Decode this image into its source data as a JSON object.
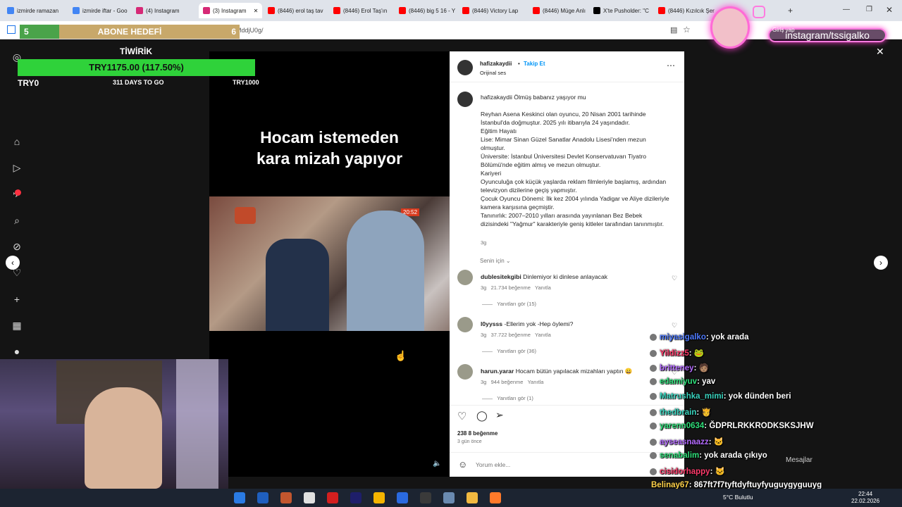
{
  "browser": {
    "tabs": [
      {
        "label": "izmirde ramazan",
        "color": "#4285f4"
      },
      {
        "label": "izmirde iftar - Goo",
        "color": "#4285f4"
      },
      {
        "label": "(4) Instagram",
        "color": "#d62976"
      },
      {
        "label": "(3) Instagram",
        "color": "#d62976",
        "active": true
      },
      {
        "label": "(8446) erol taş tav",
        "color": "#ff0000"
      },
      {
        "label": "(8446) Erol Taş'ın",
        "color": "#ff0000"
      },
      {
        "label": "(8446) big 5 16 - Y",
        "color": "#ff0000"
      },
      {
        "label": "(8446) Victory Lap",
        "color": "#ff0000"
      },
      {
        "label": "(8446) Müge Anlı",
        "color": "#ff0000"
      },
      {
        "label": "X'te Pusholder: \"C",
        "color": "#000000"
      },
      {
        "label": "(8446) Kızılcık Şer",
        "color": "#ff0000"
      }
    ],
    "url": "com/p/DU78MddjU0g/",
    "login_label": "Giriş yap"
  },
  "goal": {
    "head_left": "5",
    "title": "ABONE HEDEFİ",
    "head_right": "6",
    "name": "TİWİRİK",
    "amount": "TRY1175.00 (117.50%)",
    "progress": 1.0,
    "min": "TRY0",
    "days": "311 DAYS TO GO",
    "max": "TRY1000"
  },
  "video": {
    "caption_line1": "Hocam istemeden",
    "caption_line2": "kara mizah yapıyor",
    "clip_timestamp": "20:52"
  },
  "post": {
    "username": "hafizakaydii",
    "follow_label": "Takip Et",
    "audio": "Orijinal ses",
    "caption_user": "hafizakaydii",
    "caption_text": "Ölmüş babanız yaşıyor mu",
    "description": "Reyhan Asena Keskinci olan oyuncu, 20 Nisan 2001 tarihinde İstanbul'da doğmuştur. 2025 yılı itibarıyla 24 yaşındadır.\nEğitim Hayatı\nLise: Mimar Sinan Güzel Sanatlar Anadolu Lisesi'nden mezun olmuştur.\nÜniversite: İstanbul Üniversitesi Devlet Konservatuvarı Tiyatro Bölümü'nde eğitim almış ve mezun olmuştur.\nKariyeri\nOyunculuğa çok küçük yaşlarda reklam filmleriyle başlamış, ardından televizyon dizilerine geçiş yapmıştır.\nÇocuk Oyuncu Dönemi: İlk kez 2004 yılında Yadigar ve Aliye dizileriyle kamera karşısına geçmiştir.\nTanınırlık: 2007–2010 yılları arasında yayınlanan Bez Bebek dizisindeki \"Yağmur\" karakteriyle geniş kitleler tarafından tanınmıştır.",
    "desc_age": "3g",
    "for_you": "Senin için",
    "comments": [
      {
        "user": "dublesitekgibi",
        "text": "Dinlemiyor ki dinlese anlayacak",
        "age": "3g",
        "likes": "21.734 beğenme",
        "reply": "Yanıtla",
        "view_replies": "Yanıtları gör (15)"
      },
      {
        "user": "l0yysss",
        "text": "-Ellerim yok -Hep öylemi?",
        "age": "3g",
        "likes": "37.722 beğenme",
        "reply": "Yanıtla",
        "view_replies": "Yanıtları gör (36)"
      },
      {
        "user": "harun.yarar",
        "text": "Hocam bütün yapılacak mizahları yaptın 😀",
        "age": "3g",
        "likes": "944 beğenme",
        "reply": "Yanıtla",
        "view_replies": "Yanıtları gör (1)"
      }
    ],
    "like_count": "238 8 beğenme",
    "post_age": "3 gün önce",
    "comment_placeholder": "Yorum ekle..."
  },
  "stream": {
    "instagram_handle": "instagram/tssigalko",
    "messages_label": "Mesajlar"
  },
  "chat": [
    {
      "user": "miyasigalko",
      "text": ": yok arada",
      "color": "#4f7bff"
    },
    {
      "user": "Yildizz5",
      "text": ": 🐸",
      "color": "#ff3b6b"
    },
    {
      "user": "britteney",
      "text": ": 🧑🏽",
      "color": "#b46bff"
    },
    {
      "user": "edamiyuv",
      "text": ": yav",
      "color": "#2fe07a"
    },
    {
      "user": "Matrushka_mimi",
      "text": ": yok dünden beri",
      "color": "#3ad6c0"
    },
    {
      "user": "thedbrain",
      "text": ": 🫅",
      "color": "#3ad6c0"
    },
    {
      "user": "yarenn0634",
      "text": ": ĞDPRLRKKRODKSKSJHW",
      "color": "#2fe07a"
    },
    {
      "user": "ayseasnaazz",
      "text": ": 🐱",
      "color": "#b46bff"
    },
    {
      "user": "senabalim",
      "text": ": yok arada çıkıyo",
      "color": "#2fe07a"
    },
    {
      "user": "cisidorhappy",
      "text": ": 🐱",
      "color": "#ff3b6b"
    },
    {
      "user": "Belinay67",
      "text": ": 867ft7f7tyftdyftuyfyuguygyguuyg",
      "color": "#ffd24a"
    }
  ],
  "taskbar": {
    "weather": "5°C Bulutlu",
    "time": "22:44",
    "date": "22.02.2026"
  }
}
